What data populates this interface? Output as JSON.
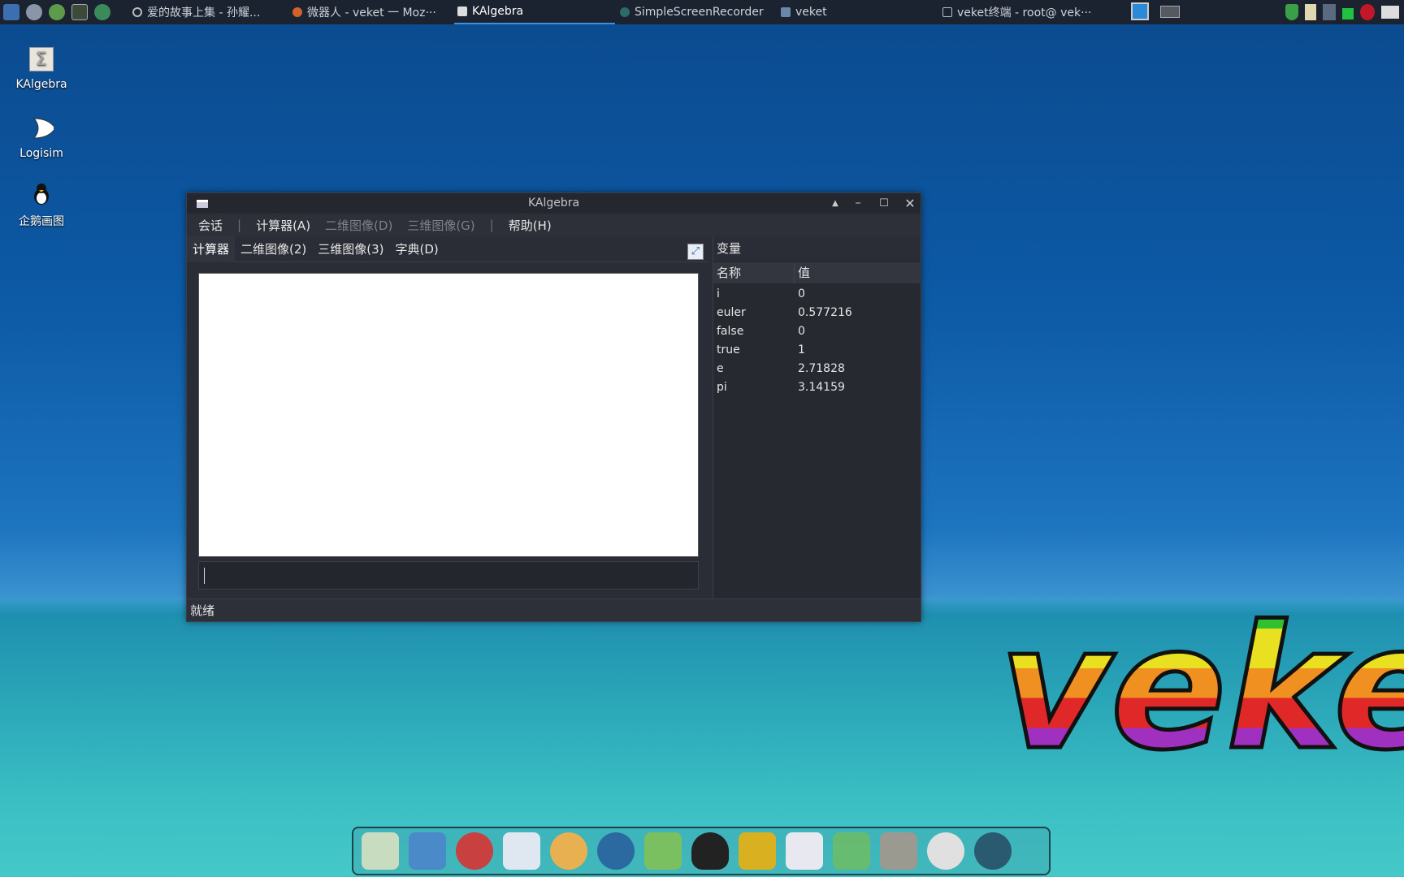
{
  "taskbar": {
    "tasks": [
      {
        "label": "爱的故事上集 - 孙耀...",
        "icon": "media-icon"
      },
      {
        "label": "微器人 - veket 一 Moz···",
        "icon": "firefox-icon"
      },
      {
        "label": "KAlgebra",
        "icon": "window-icon",
        "active": true
      },
      {
        "label": "SimpleScreenRecorder",
        "icon": "recorder-icon"
      },
      {
        "label": "veket",
        "icon": "folder-icon"
      },
      {
        "label": "veket终端 - root@ vek···",
        "icon": "terminal-icon"
      }
    ]
  },
  "desktop": {
    "icons": [
      {
        "label": "KAlgebra",
        "icon": "sigma-icon"
      },
      {
        "label": "Logisim",
        "icon": "or-gate-icon"
      },
      {
        "label": "企鹅画图",
        "icon": "penguin-icon"
      }
    ]
  },
  "window": {
    "title": "KAlgebra",
    "menu": [
      "会话",
      "计算器(A)",
      "二维图像(D)",
      "三维图像(G)",
      "帮助(H)"
    ],
    "tabs": [
      "计算器",
      "二维图像(2)",
      "三维图像(3)",
      "字典(D)"
    ],
    "input_value": "",
    "variables": {
      "title": "变量",
      "columns": [
        "名称",
        "值"
      ],
      "rows": [
        [
          "i",
          "0"
        ],
        [
          "euler",
          "0.577216"
        ],
        [
          "false",
          "0"
        ],
        [
          "true",
          "1"
        ],
        [
          "e",
          "2.71828"
        ],
        [
          "pi",
          "3.14159"
        ]
      ]
    },
    "status": "就绪"
  },
  "wallpaper": {
    "logo": "veket"
  },
  "colors": {
    "taskbar": "#1b2230",
    "window": "#2a2d35",
    "accent": "#3d8fe0"
  }
}
